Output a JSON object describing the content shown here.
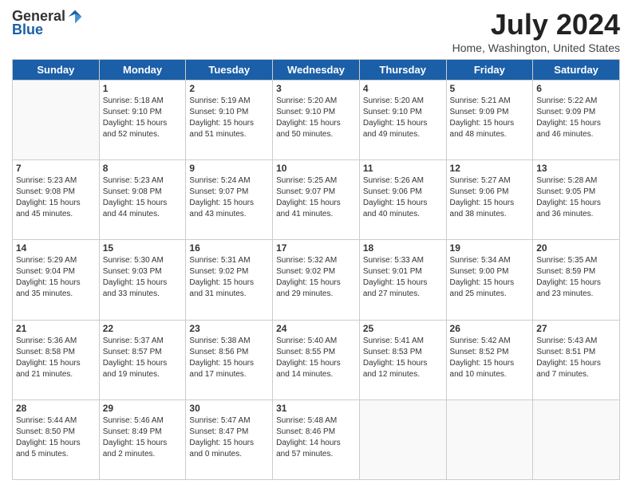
{
  "logo": {
    "general": "General",
    "blue": "Blue"
  },
  "header": {
    "month_year": "July 2024",
    "location": "Home, Washington, United States"
  },
  "columns": [
    "Sunday",
    "Monday",
    "Tuesday",
    "Wednesday",
    "Thursday",
    "Friday",
    "Saturday"
  ],
  "weeks": [
    [
      {
        "day": "",
        "info": ""
      },
      {
        "day": "1",
        "info": "Sunrise: 5:18 AM\nSunset: 9:10 PM\nDaylight: 15 hours\nand 52 minutes."
      },
      {
        "day": "2",
        "info": "Sunrise: 5:19 AM\nSunset: 9:10 PM\nDaylight: 15 hours\nand 51 minutes."
      },
      {
        "day": "3",
        "info": "Sunrise: 5:20 AM\nSunset: 9:10 PM\nDaylight: 15 hours\nand 50 minutes."
      },
      {
        "day": "4",
        "info": "Sunrise: 5:20 AM\nSunset: 9:10 PM\nDaylight: 15 hours\nand 49 minutes."
      },
      {
        "day": "5",
        "info": "Sunrise: 5:21 AM\nSunset: 9:09 PM\nDaylight: 15 hours\nand 48 minutes."
      },
      {
        "day": "6",
        "info": "Sunrise: 5:22 AM\nSunset: 9:09 PM\nDaylight: 15 hours\nand 46 minutes."
      }
    ],
    [
      {
        "day": "7",
        "info": "Sunrise: 5:23 AM\nSunset: 9:08 PM\nDaylight: 15 hours\nand 45 minutes."
      },
      {
        "day": "8",
        "info": "Sunrise: 5:23 AM\nSunset: 9:08 PM\nDaylight: 15 hours\nand 44 minutes."
      },
      {
        "day": "9",
        "info": "Sunrise: 5:24 AM\nSunset: 9:07 PM\nDaylight: 15 hours\nand 43 minutes."
      },
      {
        "day": "10",
        "info": "Sunrise: 5:25 AM\nSunset: 9:07 PM\nDaylight: 15 hours\nand 41 minutes."
      },
      {
        "day": "11",
        "info": "Sunrise: 5:26 AM\nSunset: 9:06 PM\nDaylight: 15 hours\nand 40 minutes."
      },
      {
        "day": "12",
        "info": "Sunrise: 5:27 AM\nSunset: 9:06 PM\nDaylight: 15 hours\nand 38 minutes."
      },
      {
        "day": "13",
        "info": "Sunrise: 5:28 AM\nSunset: 9:05 PM\nDaylight: 15 hours\nand 36 minutes."
      }
    ],
    [
      {
        "day": "14",
        "info": "Sunrise: 5:29 AM\nSunset: 9:04 PM\nDaylight: 15 hours\nand 35 minutes."
      },
      {
        "day": "15",
        "info": "Sunrise: 5:30 AM\nSunset: 9:03 PM\nDaylight: 15 hours\nand 33 minutes."
      },
      {
        "day": "16",
        "info": "Sunrise: 5:31 AM\nSunset: 9:02 PM\nDaylight: 15 hours\nand 31 minutes."
      },
      {
        "day": "17",
        "info": "Sunrise: 5:32 AM\nSunset: 9:02 PM\nDaylight: 15 hours\nand 29 minutes."
      },
      {
        "day": "18",
        "info": "Sunrise: 5:33 AM\nSunset: 9:01 PM\nDaylight: 15 hours\nand 27 minutes."
      },
      {
        "day": "19",
        "info": "Sunrise: 5:34 AM\nSunset: 9:00 PM\nDaylight: 15 hours\nand 25 minutes."
      },
      {
        "day": "20",
        "info": "Sunrise: 5:35 AM\nSunset: 8:59 PM\nDaylight: 15 hours\nand 23 minutes."
      }
    ],
    [
      {
        "day": "21",
        "info": "Sunrise: 5:36 AM\nSunset: 8:58 PM\nDaylight: 15 hours\nand 21 minutes."
      },
      {
        "day": "22",
        "info": "Sunrise: 5:37 AM\nSunset: 8:57 PM\nDaylight: 15 hours\nand 19 minutes."
      },
      {
        "day": "23",
        "info": "Sunrise: 5:38 AM\nSunset: 8:56 PM\nDaylight: 15 hours\nand 17 minutes."
      },
      {
        "day": "24",
        "info": "Sunrise: 5:40 AM\nSunset: 8:55 PM\nDaylight: 15 hours\nand 14 minutes."
      },
      {
        "day": "25",
        "info": "Sunrise: 5:41 AM\nSunset: 8:53 PM\nDaylight: 15 hours\nand 12 minutes."
      },
      {
        "day": "26",
        "info": "Sunrise: 5:42 AM\nSunset: 8:52 PM\nDaylight: 15 hours\nand 10 minutes."
      },
      {
        "day": "27",
        "info": "Sunrise: 5:43 AM\nSunset: 8:51 PM\nDaylight: 15 hours\nand 7 minutes."
      }
    ],
    [
      {
        "day": "28",
        "info": "Sunrise: 5:44 AM\nSunset: 8:50 PM\nDaylight: 15 hours\nand 5 minutes."
      },
      {
        "day": "29",
        "info": "Sunrise: 5:46 AM\nSunset: 8:49 PM\nDaylight: 15 hours\nand 2 minutes."
      },
      {
        "day": "30",
        "info": "Sunrise: 5:47 AM\nSunset: 8:47 PM\nDaylight: 15 hours\nand 0 minutes."
      },
      {
        "day": "31",
        "info": "Sunrise: 5:48 AM\nSunset: 8:46 PM\nDaylight: 14 hours\nand 57 minutes."
      },
      {
        "day": "",
        "info": ""
      },
      {
        "day": "",
        "info": ""
      },
      {
        "day": "",
        "info": ""
      }
    ]
  ]
}
